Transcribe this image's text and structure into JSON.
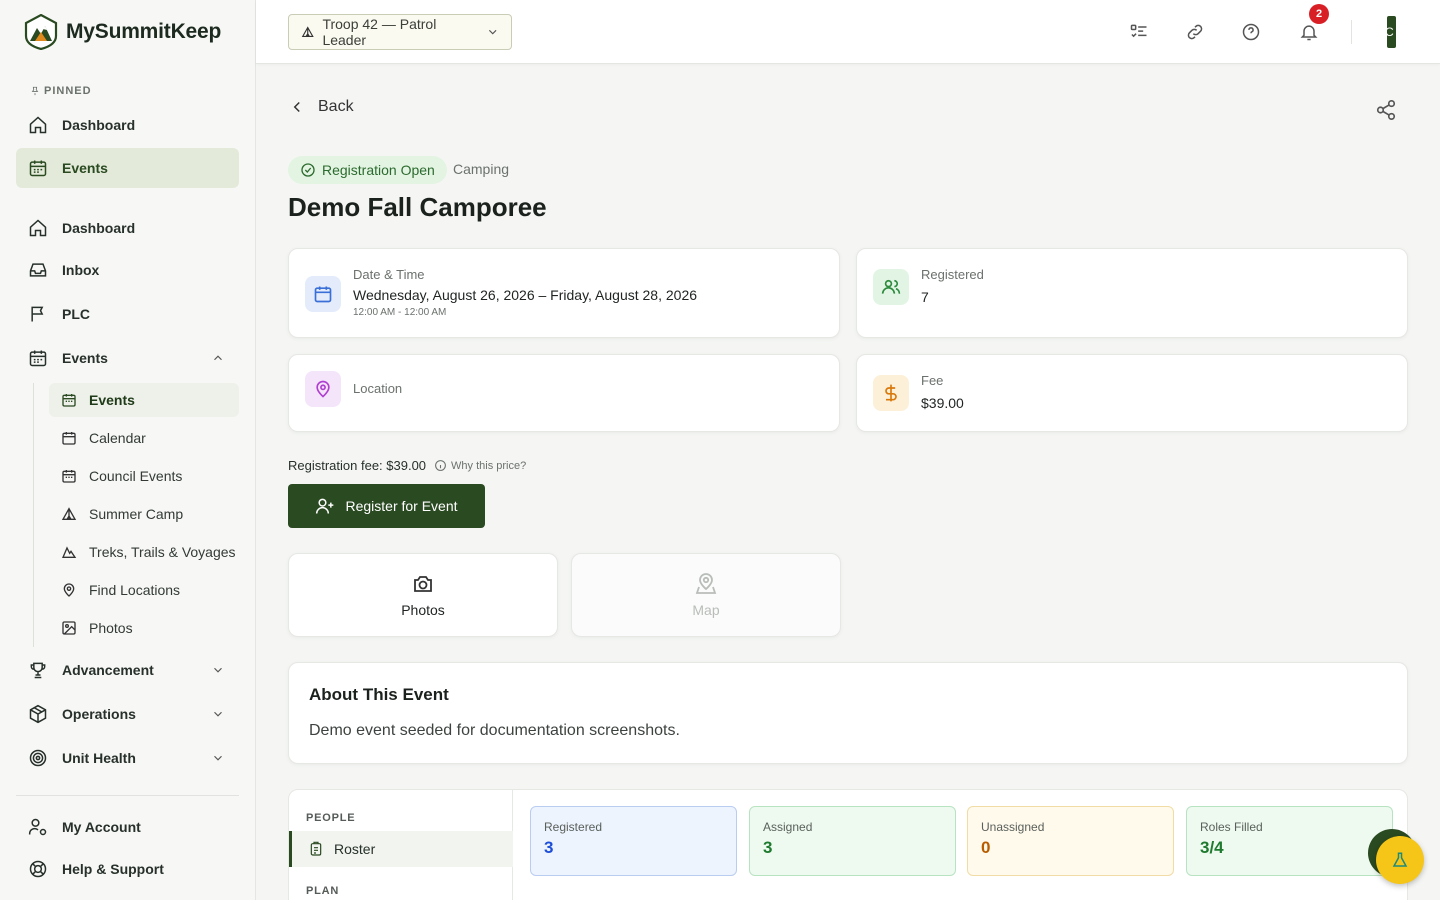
{
  "app": {
    "name": "MySummitKeep"
  },
  "sidebar": {
    "pinned_label": "PINNED",
    "pinned": [
      {
        "label": "Dashboard",
        "icon": "home-icon"
      },
      {
        "label": "Events",
        "icon": "calendar-icon"
      }
    ],
    "main": [
      {
        "label": "Dashboard",
        "icon": "home-icon"
      },
      {
        "label": "Inbox",
        "icon": "inbox-icon"
      },
      {
        "label": "PLC",
        "icon": "flag-icon"
      },
      {
        "label": "Events",
        "icon": "calendar-icon"
      }
    ],
    "events_sub": [
      {
        "label": "Events",
        "icon": "calendar-icon"
      },
      {
        "label": "Calendar",
        "icon": "calendar-icon"
      },
      {
        "label": "Council Events",
        "icon": "calendar-icon"
      },
      {
        "label": "Summer Camp",
        "icon": "tent-icon"
      },
      {
        "label": "Treks, Trails & Voyages",
        "icon": "mountain-icon"
      },
      {
        "label": "Find Locations",
        "icon": "map-pin-icon"
      },
      {
        "label": "Photos",
        "icon": "image-icon"
      }
    ],
    "groups": [
      {
        "label": "Advancement",
        "icon": "trophy-icon"
      },
      {
        "label": "Operations",
        "icon": "box-icon"
      },
      {
        "label": "Unit Health",
        "icon": "target-icon"
      }
    ],
    "footer": [
      {
        "label": "My Account",
        "icon": "user-cog-icon"
      },
      {
        "label": "Help & Support",
        "icon": "lifebuoy-icon"
      }
    ]
  },
  "topbar": {
    "unit_selector": "Troop 42 — Patrol Leader",
    "notification_count": "2",
    "avatar_initial": "C"
  },
  "event": {
    "back_label": "Back",
    "status": "Registration Open",
    "category": "Camping",
    "title": "Demo Fall Camporee",
    "date_label": "Date & Time",
    "date_value": "Wednesday, August 26, 2026 – Friday, August 28, 2026",
    "time_value": "12:00 AM - 12:00 AM",
    "registered_label": "Registered",
    "registered_value": "7",
    "location_label": "Location",
    "fee_label": "Fee",
    "fee_value": "$39.00",
    "registration_fee_text": "Registration fee: $39.00",
    "why_price": "Why this price?",
    "register_button": "Register for Event",
    "tiles": {
      "photos": "Photos",
      "map": "Map"
    },
    "about_title": "About This Event",
    "about_text": "Demo event seeded for documentation screenshots."
  },
  "people": {
    "group_people": "PEOPLE",
    "roster": "Roster",
    "group_plan": "PLAN",
    "stats": [
      {
        "label": "Registered",
        "value": "3",
        "color": "#1d4ed8",
        "bg": "#eef4fd",
        "border": "#b9cdf1"
      },
      {
        "label": "Assigned",
        "value": "3",
        "color": "#1e7a2e",
        "bg": "#eefaf0",
        "border": "#b8e3c1"
      },
      {
        "label": "Unassigned",
        "value": "0",
        "color": "#b85c00",
        "bg": "#fffaec",
        "border": "#f1dca6"
      },
      {
        "label": "Roles Filled",
        "value": "3/4",
        "color": "#1e7a2e",
        "bg": "#eefaf0",
        "border": "#b8e3c1"
      }
    ]
  },
  "colors": {
    "brand": "#2a4a21",
    "accent_yellow": "#f5c518",
    "badge_red": "#d91f26"
  }
}
